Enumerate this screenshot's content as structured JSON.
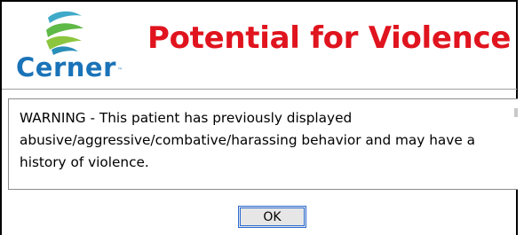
{
  "header": {
    "logo_text": "Cerner",
    "logo_trademark": "™",
    "title": "Potential for Violence"
  },
  "message": {
    "text": "WARNING - This patient has previously displayed abusive/aggressive/combative/harassing behavior and may have a history of violence."
  },
  "actions": {
    "ok_label": "OK"
  },
  "colors": {
    "title": "#e0141e",
    "brand_blue": "#1a73b8",
    "brand_green": "#5fb946",
    "button_focus": "#2b6cd4"
  },
  "icons": {
    "logo_mark": "cerner-logo-icon"
  }
}
